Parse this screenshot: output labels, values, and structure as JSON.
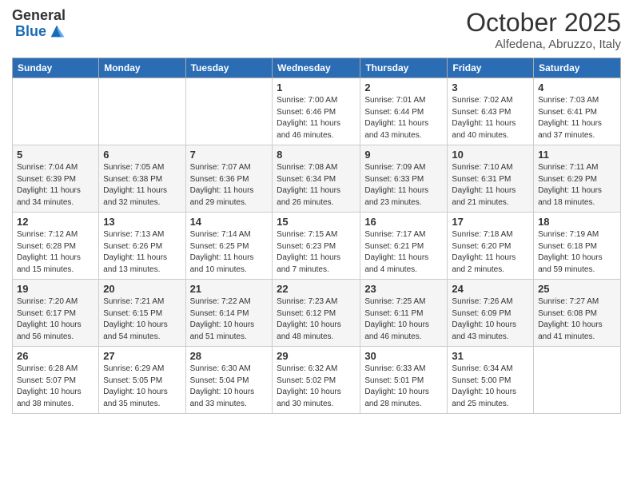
{
  "header": {
    "logo_general": "General",
    "logo_blue": "Blue",
    "month": "October 2025",
    "location": "Alfedena, Abruzzo, Italy"
  },
  "weekdays": [
    "Sunday",
    "Monday",
    "Tuesday",
    "Wednesday",
    "Thursday",
    "Friday",
    "Saturday"
  ],
  "weeks": [
    [
      {
        "day": "",
        "info": ""
      },
      {
        "day": "",
        "info": ""
      },
      {
        "day": "",
        "info": ""
      },
      {
        "day": "1",
        "info": "Sunrise: 7:00 AM\nSunset: 6:46 PM\nDaylight: 11 hours and 46 minutes."
      },
      {
        "day": "2",
        "info": "Sunrise: 7:01 AM\nSunset: 6:44 PM\nDaylight: 11 hours and 43 minutes."
      },
      {
        "day": "3",
        "info": "Sunrise: 7:02 AM\nSunset: 6:43 PM\nDaylight: 11 hours and 40 minutes."
      },
      {
        "day": "4",
        "info": "Sunrise: 7:03 AM\nSunset: 6:41 PM\nDaylight: 11 hours and 37 minutes."
      }
    ],
    [
      {
        "day": "5",
        "info": "Sunrise: 7:04 AM\nSunset: 6:39 PM\nDaylight: 11 hours and 34 minutes."
      },
      {
        "day": "6",
        "info": "Sunrise: 7:05 AM\nSunset: 6:38 PM\nDaylight: 11 hours and 32 minutes."
      },
      {
        "day": "7",
        "info": "Sunrise: 7:07 AM\nSunset: 6:36 PM\nDaylight: 11 hours and 29 minutes."
      },
      {
        "day": "8",
        "info": "Sunrise: 7:08 AM\nSunset: 6:34 PM\nDaylight: 11 hours and 26 minutes."
      },
      {
        "day": "9",
        "info": "Sunrise: 7:09 AM\nSunset: 6:33 PM\nDaylight: 11 hours and 23 minutes."
      },
      {
        "day": "10",
        "info": "Sunrise: 7:10 AM\nSunset: 6:31 PM\nDaylight: 11 hours and 21 minutes."
      },
      {
        "day": "11",
        "info": "Sunrise: 7:11 AM\nSunset: 6:29 PM\nDaylight: 11 hours and 18 minutes."
      }
    ],
    [
      {
        "day": "12",
        "info": "Sunrise: 7:12 AM\nSunset: 6:28 PM\nDaylight: 11 hours and 15 minutes."
      },
      {
        "day": "13",
        "info": "Sunrise: 7:13 AM\nSunset: 6:26 PM\nDaylight: 11 hours and 13 minutes."
      },
      {
        "day": "14",
        "info": "Sunrise: 7:14 AM\nSunset: 6:25 PM\nDaylight: 11 hours and 10 minutes."
      },
      {
        "day": "15",
        "info": "Sunrise: 7:15 AM\nSunset: 6:23 PM\nDaylight: 11 hours and 7 minutes."
      },
      {
        "day": "16",
        "info": "Sunrise: 7:17 AM\nSunset: 6:21 PM\nDaylight: 11 hours and 4 minutes."
      },
      {
        "day": "17",
        "info": "Sunrise: 7:18 AM\nSunset: 6:20 PM\nDaylight: 11 hours and 2 minutes."
      },
      {
        "day": "18",
        "info": "Sunrise: 7:19 AM\nSunset: 6:18 PM\nDaylight: 10 hours and 59 minutes."
      }
    ],
    [
      {
        "day": "19",
        "info": "Sunrise: 7:20 AM\nSunset: 6:17 PM\nDaylight: 10 hours and 56 minutes."
      },
      {
        "day": "20",
        "info": "Sunrise: 7:21 AM\nSunset: 6:15 PM\nDaylight: 10 hours and 54 minutes."
      },
      {
        "day": "21",
        "info": "Sunrise: 7:22 AM\nSunset: 6:14 PM\nDaylight: 10 hours and 51 minutes."
      },
      {
        "day": "22",
        "info": "Sunrise: 7:23 AM\nSunset: 6:12 PM\nDaylight: 10 hours and 48 minutes."
      },
      {
        "day": "23",
        "info": "Sunrise: 7:25 AM\nSunset: 6:11 PM\nDaylight: 10 hours and 46 minutes."
      },
      {
        "day": "24",
        "info": "Sunrise: 7:26 AM\nSunset: 6:09 PM\nDaylight: 10 hours and 43 minutes."
      },
      {
        "day": "25",
        "info": "Sunrise: 7:27 AM\nSunset: 6:08 PM\nDaylight: 10 hours and 41 minutes."
      }
    ],
    [
      {
        "day": "26",
        "info": "Sunrise: 6:28 AM\nSunset: 5:07 PM\nDaylight: 10 hours and 38 minutes."
      },
      {
        "day": "27",
        "info": "Sunrise: 6:29 AM\nSunset: 5:05 PM\nDaylight: 10 hours and 35 minutes."
      },
      {
        "day": "28",
        "info": "Sunrise: 6:30 AM\nSunset: 5:04 PM\nDaylight: 10 hours and 33 minutes."
      },
      {
        "day": "29",
        "info": "Sunrise: 6:32 AM\nSunset: 5:02 PM\nDaylight: 10 hours and 30 minutes."
      },
      {
        "day": "30",
        "info": "Sunrise: 6:33 AM\nSunset: 5:01 PM\nDaylight: 10 hours and 28 minutes."
      },
      {
        "day": "31",
        "info": "Sunrise: 6:34 AM\nSunset: 5:00 PM\nDaylight: 10 hours and 25 minutes."
      },
      {
        "day": "",
        "info": ""
      }
    ]
  ]
}
